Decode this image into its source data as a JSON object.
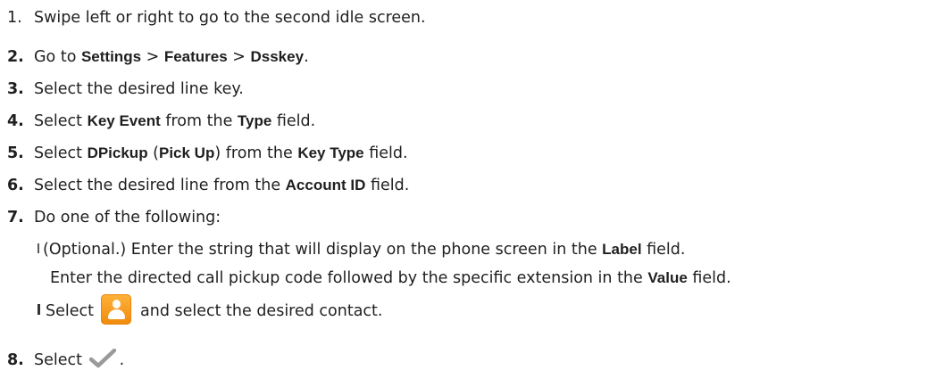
{
  "steps": {
    "s1": {
      "num": "1.",
      "text": "Swipe left or right to go to the second idle screen."
    },
    "s2": {
      "num": "2.",
      "pre": "Go to ",
      "a": "Settings",
      "sep1": " > ",
      "b": "Features",
      "sep2": " > ",
      "c": "Dsskey",
      "post": "."
    },
    "s3": {
      "num": "3.",
      "text": "Select the desired line key."
    },
    "s4": {
      "num": "4.",
      "pre": "Select ",
      "a": "Key Event",
      "mid": " from the ",
      "b": "Type",
      "post": " field."
    },
    "s5": {
      "num": "5.",
      "pre": "Select ",
      "a": "DPickup",
      "mid1": " (",
      "b": "Pick Up",
      "mid2": ") from the ",
      "c": "Key Type",
      "post": " field."
    },
    "s6": {
      "num": "6.",
      "pre": "Select the desired line from the ",
      "a": "Account ID",
      "post": " field."
    },
    "s7": {
      "num": "7.",
      "text": "Do one of the following:",
      "opt1": {
        "pre": "(Optional.) Enter the string that will display on the phone screen in the ",
        "a": "Label",
        "post": " field."
      },
      "opt1b": {
        "pre": "Enter the directed call pickup code followed by the specific extension in the ",
        "a": "Value",
        "post": " field."
      },
      "opt2": {
        "pre": "Select",
        "post": "and select the desired contact."
      }
    },
    "s8": {
      "num": "8.",
      "pre": "Select",
      "post": "."
    }
  },
  "icons": {
    "contact": "contact-directory-icon",
    "save": "checkmark-save-icon"
  },
  "colors": {
    "contact_icon": "#f5950f",
    "checkmark": "#9a9a9a"
  }
}
